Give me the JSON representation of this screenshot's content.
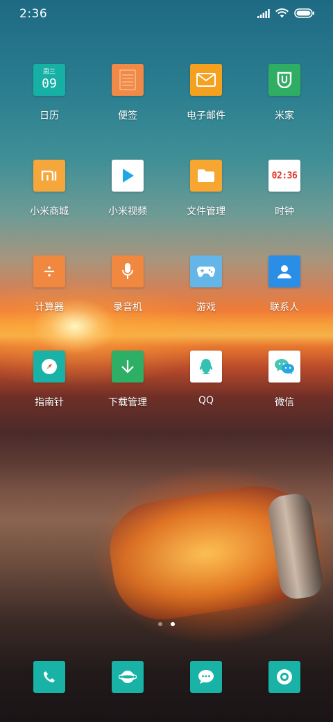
{
  "status": {
    "time": "2:36"
  },
  "apps": [
    {
      "label": "日历",
      "icon": "calendar-icon",
      "color": "#16b1a4",
      "cal_day": "周三",
      "cal_date": "09"
    },
    {
      "label": "便签",
      "icon": "notes-icon",
      "color": "#f28a47"
    },
    {
      "label": "电子邮件",
      "icon": "mail-icon",
      "color": "#f5a11f"
    },
    {
      "label": "米家",
      "icon": "mijia-icon",
      "color": "#2fae63"
    },
    {
      "label": "小米商城",
      "icon": "mi-store-icon",
      "color": "#f5a73c"
    },
    {
      "label": "小米视频",
      "icon": "video-play-icon",
      "color": "#ffffff"
    },
    {
      "label": "文件管理",
      "icon": "folder-icon",
      "color": "#f6a631"
    },
    {
      "label": "时钟",
      "icon": "clock-icon",
      "color": "#ffffff",
      "clock_text": "02:36"
    },
    {
      "label": "计算器",
      "icon": "calculator-icon",
      "color": "#f0883f"
    },
    {
      "label": "录音机",
      "icon": "microphone-icon",
      "color": "#f0883f"
    },
    {
      "label": "游戏",
      "icon": "gamepad-icon",
      "color": "#64b6e8"
    },
    {
      "label": "联系人",
      "icon": "contact-icon",
      "color": "#2a8ee6"
    },
    {
      "label": "指南针",
      "icon": "compass-icon",
      "color": "#18b2a6"
    },
    {
      "label": "下载管理",
      "icon": "download-icon",
      "color": "#2db066"
    },
    {
      "label": "QQ",
      "icon": "qq-icon",
      "color": "#ffffff"
    },
    {
      "label": "微信",
      "icon": "wechat-icon",
      "color": "#ffffff"
    }
  ],
  "dock": [
    {
      "icon": "phone-icon",
      "color": "#18b2a6"
    },
    {
      "icon": "browser-icon",
      "color": "#18b2a6"
    },
    {
      "icon": "messages-icon",
      "color": "#18b2a6"
    },
    {
      "icon": "camera-icon",
      "color": "#18b2a6"
    }
  ],
  "pager": {
    "pages": 2,
    "current": 1
  }
}
